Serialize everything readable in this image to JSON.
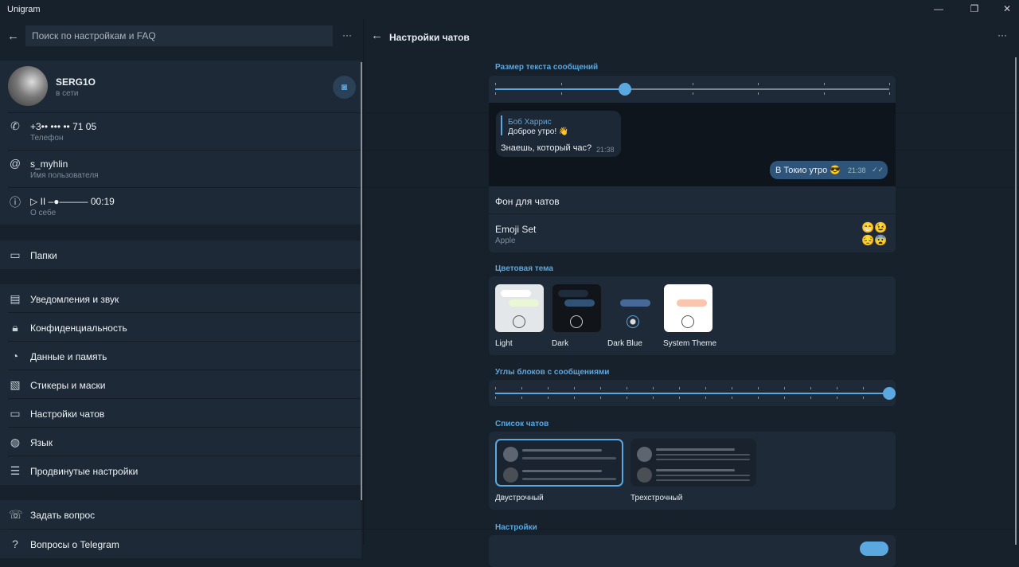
{
  "app": {
    "title": "Unigram"
  },
  "window": {
    "minimize": "—",
    "maximize": "❐",
    "close": "✕"
  },
  "left": {
    "search_placeholder": "Поиск по настройкам и FAQ",
    "more": "···",
    "profile": {
      "name": "SERG1O",
      "status": "в сети"
    },
    "phone": {
      "value": "+3•• ••• •• 71 05",
      "label": "Телефон"
    },
    "username": {
      "value": "s_myhlin",
      "label": "Имя пользователя"
    },
    "bio": {
      "value": "▷ II –●——— 00:19",
      "label": "О себе"
    },
    "folders": "Папки",
    "menu": [
      {
        "icon": "notifications-icon",
        "glyph": "▤",
        "label": "Уведомления и звук"
      },
      {
        "icon": "lock-icon",
        "glyph": "🔒︎",
        "label": "Конфиденциальность"
      },
      {
        "icon": "data-icon",
        "glyph": "◔",
        "label": "Данные и память"
      },
      {
        "icon": "sticker-icon",
        "glyph": "▧",
        "label": "Стикеры и маски"
      },
      {
        "icon": "chat-icon",
        "glyph": "▭",
        "label": "Настройки чатов"
      },
      {
        "icon": "globe-icon",
        "glyph": "◍",
        "label": "Язык"
      },
      {
        "icon": "sliders-icon",
        "glyph": "☰",
        "label": "Продвинутые настройки"
      }
    ],
    "ask": "Задать вопрос",
    "faq": "Вопросы о Telegram"
  },
  "right": {
    "title": "Настройки чатов",
    "more": "···",
    "text_size": {
      "header": "Размер текста сообщений",
      "value_fraction": 0.33,
      "steps": 7
    },
    "preview": {
      "reply_name": "Боб Харрис",
      "reply_text": "Доброе утро! 👋",
      "incoming": "Знаешь, который час?",
      "in_time": "21:38",
      "outgoing": "В Токио утро 😎",
      "out_time": "21:38"
    },
    "background": "Фон для чатов",
    "emoji": {
      "title": "Emoji Set",
      "value": "Apple",
      "preview": "😁😉😔😨"
    },
    "theme": {
      "header": "Цветовая тема",
      "options": [
        "Light",
        "Dark",
        "Dark Blue",
        "System Theme"
      ],
      "selected": "Dark Blue"
    },
    "corners": {
      "header": "Углы блоков с сообщениями",
      "value_fraction": 1.0,
      "steps": 16
    },
    "chat_list": {
      "header": "Список чатов",
      "options": [
        "Двустрочный",
        "Трехстрочный"
      ],
      "selected": "Двустрочный"
    },
    "settings_header": "Настройки"
  },
  "colors": {
    "accent": "#5ba7e0",
    "background": "#17212b",
    "card": "#1e2a37"
  }
}
